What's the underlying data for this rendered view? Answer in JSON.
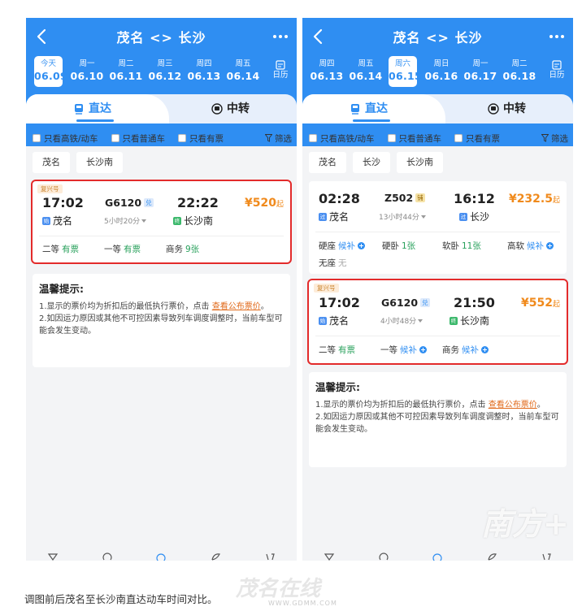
{
  "left": {
    "title": "茂名 <> 长沙",
    "dates": [
      {
        "wk": "今天",
        "dt": "06.09",
        "active": true
      },
      {
        "wk": "周一",
        "dt": "06.10"
      },
      {
        "wk": "周二",
        "dt": "06.11"
      },
      {
        "wk": "周三",
        "dt": "06.12"
      },
      {
        "wk": "周四",
        "dt": "06.13"
      },
      {
        "wk": "周五",
        "dt": "06.14"
      }
    ],
    "calendar_label": "日历",
    "tab_direct": "直达",
    "tab_transfer": "中转",
    "filters": [
      "只看高铁/动车",
      "只看普通车",
      "只看有票"
    ],
    "filter_btn": "筛选",
    "stations": [
      "茂名",
      "长沙南"
    ],
    "cards": [
      {
        "tag": "复兴号",
        "dep_time": "17:02",
        "dep_station": "茂名",
        "dep_badge": "始",
        "train_no": "G6120",
        "train_badge": "兑",
        "duration": "5小时20分",
        "arr_time": "22:22",
        "arr_station": "长沙南",
        "arr_badge": "终",
        "price": "¥520",
        "price_suffix": "起",
        "seats": [
          {
            "name": "二等",
            "status": "有票",
            "kind": "g"
          },
          {
            "name": "一等",
            "status": "有票",
            "kind": "g"
          },
          {
            "name": "商务",
            "status": "9张",
            "kind": "g"
          }
        ]
      }
    ],
    "tips_title": "温馨提示:",
    "tip1_pre": "1.显示的票价均为折扣后的最低执行票价，点击 ",
    "tip1_link": "查看公布票价",
    "tip1_post": "。",
    "tip2": "2.如因运力原因或其他不可控因素导致列车调度调整时，当前车型可能会发生变动。"
  },
  "right": {
    "title": "茂名 <> 长沙",
    "dates": [
      {
        "wk": "周四",
        "dt": "06.13"
      },
      {
        "wk": "周五",
        "dt": "06.14"
      },
      {
        "wk": "周六",
        "dt": "06.15",
        "active": true
      },
      {
        "wk": "周日",
        "dt": "06.16"
      },
      {
        "wk": "周一",
        "dt": "06.17"
      },
      {
        "wk": "周二",
        "dt": "06.18"
      }
    ],
    "calendar_label": "日历",
    "tab_direct": "直达",
    "tab_transfer": "中转",
    "filters": [
      "只看高铁/动车",
      "只看普通车",
      "只看有票"
    ],
    "filter_btn": "筛选",
    "stations": [
      "茂名",
      "长沙",
      "长沙南"
    ],
    "cards": [
      {
        "tag": "",
        "dep_time": "02:28",
        "dep_station": "茂名",
        "dep_badge": "过",
        "train_no": "Z502",
        "train_badge": "铺",
        "duration": "13小时44分",
        "arr_time": "16:12",
        "arr_station": "长沙",
        "arr_badge": "过",
        "price": "¥232.5",
        "price_suffix": "起",
        "seats": [
          {
            "name": "硬座",
            "status": "候补",
            "kind": "b",
            "plus": true
          },
          {
            "name": "硬卧",
            "status": "1张",
            "kind": "g"
          },
          {
            "name": "软卧",
            "status": "11张",
            "kind": "g"
          },
          {
            "name": "高软",
            "status": "候补",
            "kind": "b",
            "plus": true
          },
          {
            "name": "无座",
            "status": "无",
            "kind": "grey"
          }
        ]
      },
      {
        "tag": "复兴号",
        "dep_time": "17:02",
        "dep_station": "茂名",
        "dep_badge": "始",
        "train_no": "G6120",
        "train_badge": "兑",
        "duration": "4小时48分",
        "arr_time": "21:50",
        "arr_station": "长沙南",
        "arr_badge": "终",
        "price": "¥552",
        "price_suffix": "起",
        "seats": [
          {
            "name": "二等",
            "status": "有票",
            "kind": "g"
          },
          {
            "name": "一等",
            "status": "候补",
            "kind": "b",
            "plus": true
          },
          {
            "name": "商务",
            "status": "候补",
            "kind": "b",
            "plus": true
          }
        ]
      }
    ],
    "tips_title": "温馨提示:",
    "tip1_pre": "1.显示的票价均为折扣后的最低执行票价，点击 ",
    "tip1_link": "查看公布票价",
    "tip1_post": "。",
    "tip2": "2.如因运力原因或其他不可控因素导致列车调度调整时，当前车型可能会发生变动。"
  },
  "caption": "调图前后茂名至长沙南直达动车时间对比。",
  "watermark": "南方+",
  "watermark_bottom": "茂名在线",
  "watermark_url": "WWW.GDMM.COM"
}
